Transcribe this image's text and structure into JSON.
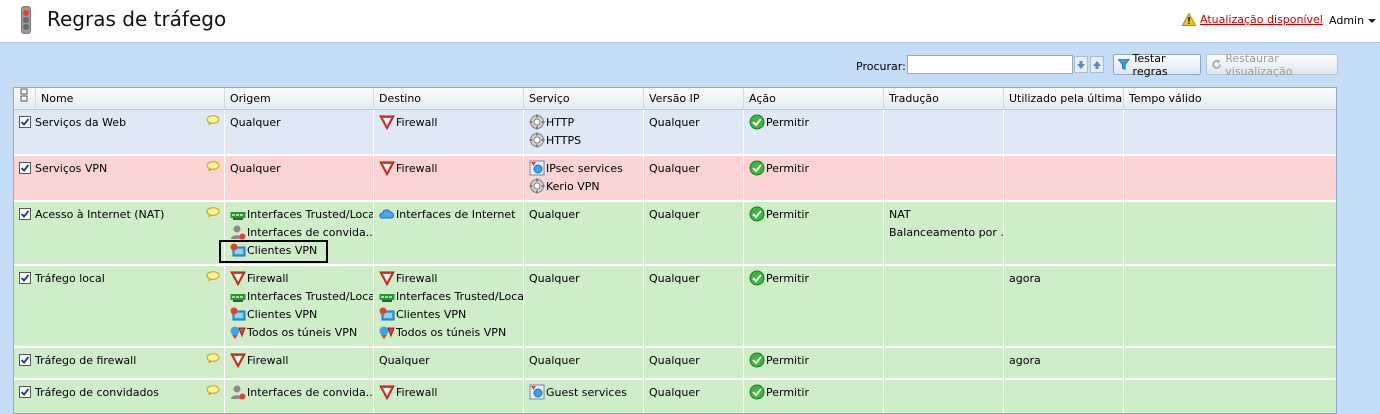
{
  "header": {
    "title": "Regras de tráfego",
    "update_link": "Atualização disponível",
    "user_menu": "Admin"
  },
  "toolbar": {
    "search_label": "Procurar:",
    "search_value": "",
    "test_rules": "Testar regras",
    "restore_view": "Restaurar visualização"
  },
  "columns": [
    "Nome",
    "Origem",
    "Destino",
    "Serviço",
    "Versão IP",
    "Ação",
    "Tradução",
    "Utilizado pela última ...",
    "Tempo válido"
  ],
  "rows": [
    {
      "checked": true,
      "name": "Serviços da Web",
      "source": [
        "Qualquer"
      ],
      "dest": [
        "Firewall"
      ],
      "service": [
        "HTTP",
        "HTTPS"
      ],
      "ip": "Qualquer",
      "action": "Permitir",
      "translation": [],
      "last_used": "",
      "valid_time": ""
    },
    {
      "checked": true,
      "name": "Serviços VPN",
      "source": [
        "Qualquer"
      ],
      "dest": [
        "Firewall"
      ],
      "service": [
        "IPsec services",
        "Kerio VPN"
      ],
      "ip": "Qualquer",
      "action": "Permitir",
      "translation": [],
      "last_used": "",
      "valid_time": ""
    },
    {
      "checked": true,
      "name": "Acesso à Internet (NAT)",
      "source": [
        "Interfaces Trusted/Local",
        "Interfaces de convida...",
        "Clientes VPN"
      ],
      "dest": [
        "Interfaces de Internet"
      ],
      "service": [
        "Qualquer"
      ],
      "ip": "Qualquer",
      "action": "Permitir",
      "translation": [
        "NAT",
        "Balanceamento por ..."
      ],
      "last_used": "",
      "valid_time": ""
    },
    {
      "checked": true,
      "name": "Tráfego local",
      "source": [
        "Firewall",
        "Interfaces Trusted/Local",
        "Clientes VPN",
        "Todos os túneis VPN"
      ],
      "dest": [
        "Firewall",
        "Interfaces Trusted/Local",
        "Clientes VPN",
        "Todos os túneis VPN"
      ],
      "service": [
        "Qualquer"
      ],
      "ip": "Qualquer",
      "action": "Permitir",
      "translation": [],
      "last_used": "agora",
      "valid_time": ""
    },
    {
      "checked": true,
      "name": "Tráfego de firewall",
      "source": [
        "Firewall"
      ],
      "dest": [
        "Qualquer"
      ],
      "service": [
        "Qualquer"
      ],
      "ip": "Qualquer",
      "action": "Permitir",
      "translation": [],
      "last_used": "agora",
      "valid_time": ""
    },
    {
      "checked": true,
      "name": "Tráfego de convidados",
      "source": [
        "Interfaces de convida..."
      ],
      "dest": [
        "Firewall"
      ],
      "service": [
        "Guest services"
      ],
      "ip": "Qualquer",
      "action": "Permitir",
      "translation": [],
      "last_used": "",
      "valid_time": ""
    }
  ],
  "icons": {
    "Firewall": "firewall-icon",
    "Interfaces Trusted/Local": "trusted-interfaces-icon",
    "Interfaces de convida...": "guest-interfaces-icon",
    "Clientes VPN": "vpn-clients-icon",
    "Todos os túneis VPN": "vpn-tunnels-icon",
    "Interfaces de Internet": "internet-interfaces-icon",
    "HTTP": "service-gear-icon",
    "HTTPS": "service-gear-icon",
    "Kerio VPN": "service-gear-icon",
    "IPsec services": "service-group-icon",
    "Guest services": "service-group-icon"
  },
  "colors": {
    "row_web": "#dfe8f5",
    "row_vpn": "#fdd4d4",
    "row_allow": "#cfedc9",
    "accent_blue": "#c4dcf6",
    "warning": "#cc0000"
  }
}
